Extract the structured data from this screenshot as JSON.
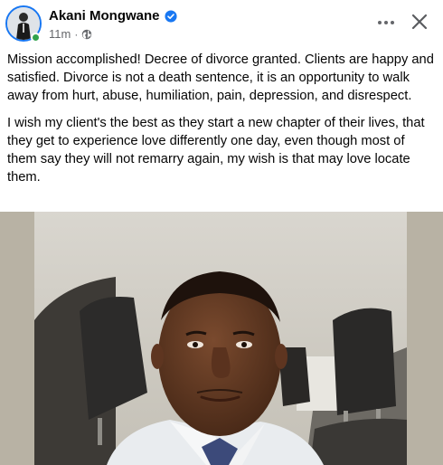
{
  "post": {
    "author": "Akani Mongwane",
    "time": "11m",
    "separator": "·",
    "paragraphs": [
      "Mission accomplished! Decree of divorce granted. Clients are happy and satisfied.  Divorce is not a death sentence, it is an opportunity to walk away from hurt, abuse, humiliation, pain, depression, and disrespect.",
      "I wish my client's the best as they start a new chapter of their lives, that they get to experience love differently one day, even though most of them say they will not remarry again, my wish is that may love locate them."
    ],
    "icons": {
      "verified": "verified-badge-icon",
      "audience": "globe-icon",
      "more": "more-options-icon",
      "close": "close-icon"
    }
  },
  "colors": {
    "brand_blue": "#1877f2",
    "secondary_text": "#65676b",
    "online_green": "#31a24c"
  }
}
